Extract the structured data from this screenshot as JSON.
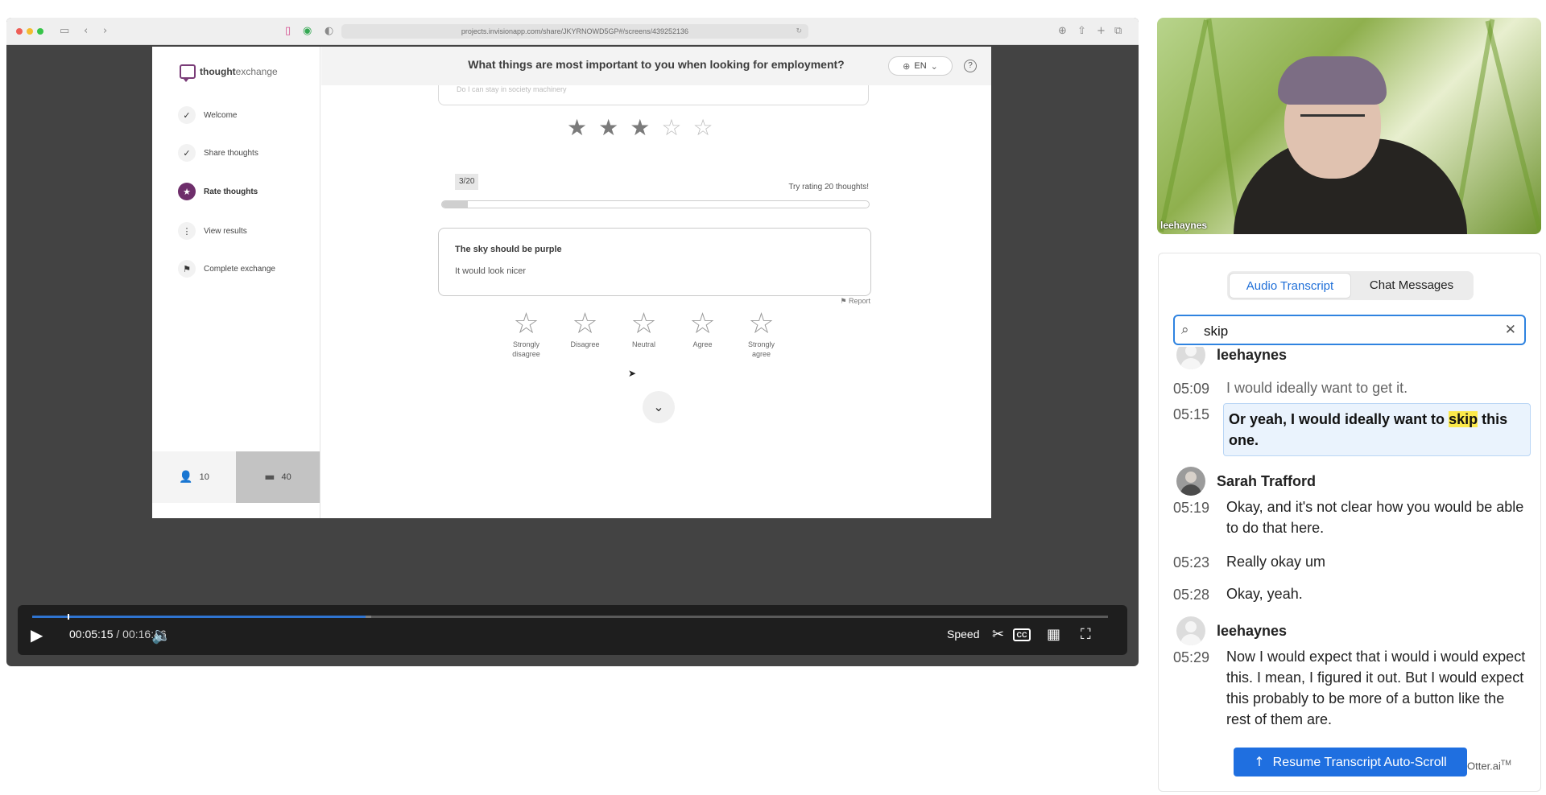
{
  "browser": {
    "url": "projects.invisionapp.com/share/JKYRNOWD5GP#/screens/439252136",
    "icons": [
      "sidebar-icon",
      "back-icon",
      "forward-icon",
      "download-icon",
      "share-icon",
      "new-tab-icon",
      "tabs-icon",
      "reload-icon"
    ]
  },
  "app": {
    "logo_prefix": "thought",
    "logo_suffix": "exchange",
    "question": "What things are most important to you when looking for employment?",
    "language": "EN",
    "help": "?",
    "steps": [
      {
        "label": "Welcome",
        "icon": "✓"
      },
      {
        "label": "Share thoughts",
        "icon": "✓"
      },
      {
        "label": "Rate thoughts",
        "icon": "★"
      },
      {
        "label": "View results",
        "icon": "⋮"
      },
      {
        "label": "Complete exchange",
        "icon": "⚑"
      }
    ],
    "participants_count": "10",
    "thoughts_count": "40",
    "previous_rating": 3,
    "previous_card_faded": "Do I can stay in society machinery",
    "progress_label": "3/20",
    "progress_fraction": 0.06,
    "progress_hint": "Try rating 20 thoughts!",
    "thought_title": "The sky should be purple",
    "thought_body": "It would look nicer",
    "report_label": "Report",
    "rating_options": [
      {
        "line1": "Strongly",
        "line2": "disagree"
      },
      {
        "line1": "Disagree",
        "line2": ""
      },
      {
        "line1": "Neutral",
        "line2": ""
      },
      {
        "line1": "Agree",
        "line2": ""
      },
      {
        "line1": "Strongly",
        "line2": "agree"
      }
    ]
  },
  "player": {
    "current_time": "00:05:15",
    "separator": "/",
    "duration": "00:16:46",
    "played_fraction": 0.31,
    "buffered_fraction": 0.315,
    "speed_label": "Speed",
    "cc_label": "CC"
  },
  "webcam": {
    "name": "leehaynes"
  },
  "transcript": {
    "tabs": [
      "Audio Transcript",
      "Chat Messages"
    ],
    "active_tab": "Audio Transcript",
    "search_value": "skip",
    "entries": [
      {
        "speaker": "leehaynes"
      },
      {
        "time": "05:09",
        "text": "I would ideally want to get it."
      },
      {
        "time": "05:15",
        "text_before": "Or yeah, I would ideally want to ",
        "match": "skip",
        "text_after": " this one."
      },
      {
        "speaker": "Sarah Trafford"
      },
      {
        "time": "05:19",
        "text": "Okay, and it's not clear how you would be able to do that here."
      },
      {
        "time": "05:23",
        "text": "Really okay um"
      },
      {
        "time": "05:28",
        "text": "Okay, yeah."
      },
      {
        "speaker": "leehaynes"
      },
      {
        "time": "05:29",
        "text": "Now I would expect that i would i would expect this. I mean, I figured it out. But I would expect this probably to be more of a button like the rest of them are."
      }
    ],
    "resume_label": "Resume Transcript Auto-Scroll",
    "brand": "Otter.ai",
    "brand_mark": "TM"
  }
}
